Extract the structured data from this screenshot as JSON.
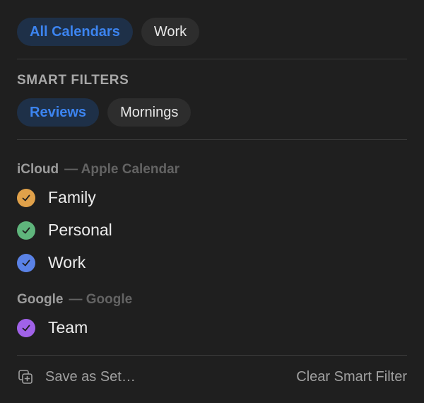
{
  "calendar_sets": [
    {
      "label": "All Calendars",
      "active": true
    },
    {
      "label": "Work",
      "active": false
    }
  ],
  "smart_filters": {
    "title": "SMART FILTERS",
    "items": [
      {
        "label": "Reviews",
        "active": true
      },
      {
        "label": "Mornings",
        "active": false
      }
    ]
  },
  "accounts": [
    {
      "name": "iCloud",
      "provider": "— Apple Calendar",
      "calendars": [
        {
          "label": "Family",
          "color": "#e0a14a",
          "checked": true,
          "icon": "check-icon"
        },
        {
          "label": "Personal",
          "color": "#5fb57c",
          "checked": true,
          "icon": "check-icon"
        },
        {
          "label": "Work",
          "color": "#5a82e6",
          "checked": true,
          "icon": "check-icon"
        }
      ]
    },
    {
      "name": "Google",
      "provider": "— Google",
      "calendars": [
        {
          "label": "Team",
          "color": "#a062e8",
          "checked": true,
          "icon": "check-icon"
        }
      ]
    }
  ],
  "footer": {
    "save_label": "Save as Set…",
    "save_icon": "duplicate-plus-icon",
    "clear_label": "Clear Smart Filter"
  }
}
